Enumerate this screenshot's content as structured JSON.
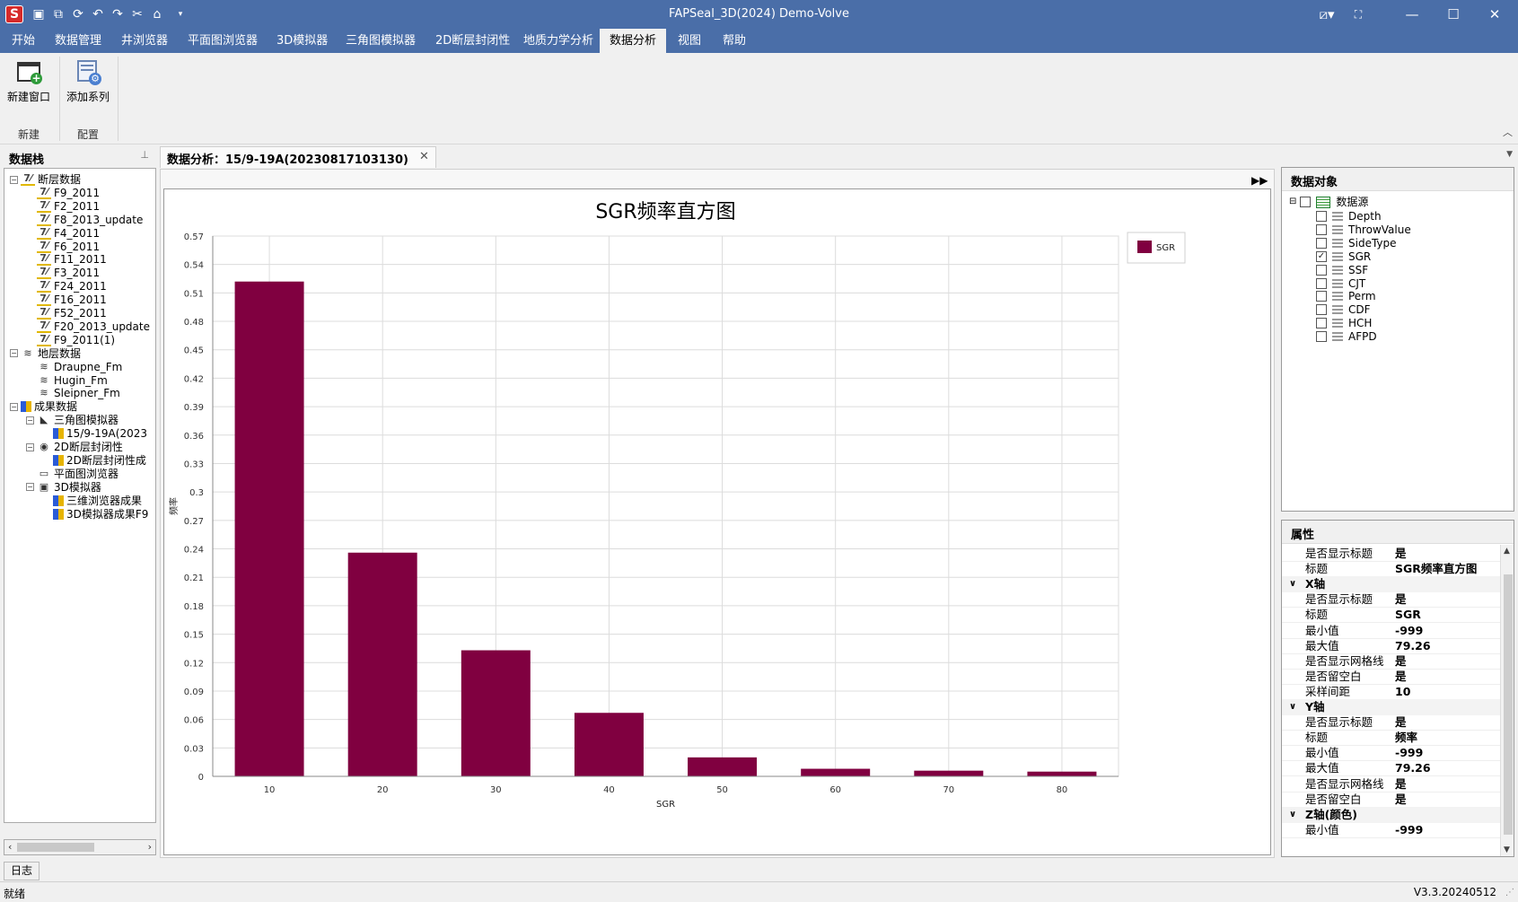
{
  "window": {
    "title": "FAPSeal_3D(2024) Demo-Volve",
    "logo_letter": "S"
  },
  "menu": [
    "开始",
    "数据管理",
    "井浏览器",
    "平面图浏览器",
    "3D模拟器",
    "三角图模拟器",
    "2D断层封闭性",
    "地质力学分析",
    "数据分析",
    "视图",
    "帮助"
  ],
  "ribbon": {
    "new_window": "新建窗口",
    "add_series": "添加系列",
    "group_new": "新建",
    "group_config": "配置"
  },
  "left_panel": {
    "title": "数据栈",
    "tree": [
      {
        "label": "断层数据",
        "level": 0,
        "icon": "fault",
        "expand": "⊟"
      },
      {
        "label": "F9_2011",
        "level": 1,
        "icon": "fault"
      },
      {
        "label": "F2_2011",
        "level": 1,
        "icon": "fault"
      },
      {
        "label": "F8_2013_update",
        "level": 1,
        "icon": "fault"
      },
      {
        "label": "F4_2011",
        "level": 1,
        "icon": "fault"
      },
      {
        "label": "F6_2011",
        "level": 1,
        "icon": "fault"
      },
      {
        "label": "F11_2011",
        "level": 1,
        "icon": "fault"
      },
      {
        "label": "F3_2011",
        "level": 1,
        "icon": "fault"
      },
      {
        "label": "F24_2011",
        "level": 1,
        "icon": "fault"
      },
      {
        "label": "F16_2011",
        "level": 1,
        "icon": "fault"
      },
      {
        "label": "F52_2011",
        "level": 1,
        "icon": "fault"
      },
      {
        "label": "F20_2013_update",
        "level": 1,
        "icon": "fault"
      },
      {
        "label": "F9_2011(1)",
        "level": 1,
        "icon": "fault"
      },
      {
        "label": "地层数据",
        "level": 0,
        "icon": "layer",
        "expand": "⊟"
      },
      {
        "label": "Draupne_Fm",
        "level": 1,
        "icon": "layer"
      },
      {
        "label": "Hugin_Fm",
        "level": 1,
        "icon": "layer"
      },
      {
        "label": "Sleipner_Fm",
        "level": 1,
        "icon": "layer"
      },
      {
        "label": "成果数据",
        "level": 0,
        "icon": "result",
        "expand": "⊟"
      },
      {
        "label": "三角图模拟器",
        "level": 1,
        "icon": "triangle",
        "expand": "⊟"
      },
      {
        "label": "15/9-19A(2023",
        "level": 2,
        "icon": "result"
      },
      {
        "label": "2D断层封闭性",
        "level": 1,
        "icon": "eye",
        "expand": "⊟"
      },
      {
        "label": "2D断层封闭性成",
        "level": 2,
        "icon": "result"
      },
      {
        "label": "平面图浏览器",
        "level": 1,
        "icon": "map"
      },
      {
        "label": "3D模拟器",
        "level": 1,
        "icon": "cube",
        "expand": "⊟"
      },
      {
        "label": "三维浏览器成果",
        "level": 2,
        "icon": "result"
      },
      {
        "label": "3D模拟器成果F9",
        "level": 2,
        "icon": "result"
      }
    ]
  },
  "doc_tab": {
    "label": "数据分析：15/9-19A(20230817103130)"
  },
  "chart_data": {
    "type": "bar",
    "title": "SGR频率直方图",
    "xlabel": "SGR",
    "ylabel": "频率",
    "categories": [
      "10",
      "20",
      "30",
      "40",
      "50",
      "60",
      "70",
      "80"
    ],
    "series": [
      {
        "name": "SGR",
        "color": "#800040",
        "values": [
          0.522,
          0.236,
          0.133,
          0.067,
          0.02,
          0.008,
          0.006,
          0.005
        ]
      }
    ],
    "y_ticks": [
      "0",
      "0.03",
      "0.06",
      "0.09",
      "0.12",
      "0.15",
      "0.18",
      "0.21",
      "0.24",
      "0.27",
      "0.3",
      "0.33",
      "0.36",
      "0.39",
      "0.42",
      "0.45",
      "0.48",
      "0.51",
      "0.54",
      "0.57"
    ],
    "ylim": [
      0,
      0.57
    ],
    "grid": true,
    "legend": "top-right"
  },
  "data_objects": {
    "title": "数据对象",
    "root": "数据源",
    "items": [
      {
        "label": "Depth",
        "checked": false
      },
      {
        "label": "ThrowValue",
        "checked": false
      },
      {
        "label": "SideType",
        "checked": false
      },
      {
        "label": "SGR",
        "checked": true
      },
      {
        "label": "SSF",
        "checked": false
      },
      {
        "label": "CJT",
        "checked": false
      },
      {
        "label": "Perm",
        "checked": false
      },
      {
        "label": "CDF",
        "checked": false
      },
      {
        "label": "HCH",
        "checked": false
      },
      {
        "label": "AFPD",
        "checked": false
      }
    ]
  },
  "properties": {
    "title": "属性",
    "rows": [
      {
        "kind": "prop",
        "name": "是否显示标题",
        "value": "是"
      },
      {
        "kind": "prop",
        "name": "标题",
        "value": "SGR频率直方图"
      },
      {
        "kind": "cat",
        "name": "X轴"
      },
      {
        "kind": "prop",
        "name": "是否显示标题",
        "value": "是"
      },
      {
        "kind": "prop",
        "name": "标题",
        "value": "SGR"
      },
      {
        "kind": "prop",
        "name": "最小值",
        "value": "-999"
      },
      {
        "kind": "prop",
        "name": "最大值",
        "value": "79.26"
      },
      {
        "kind": "prop",
        "name": "是否显示网格线",
        "value": "是"
      },
      {
        "kind": "prop",
        "name": "是否留空白",
        "value": "是"
      },
      {
        "kind": "prop",
        "name": "采样间距",
        "value": "10"
      },
      {
        "kind": "cat",
        "name": "Y轴"
      },
      {
        "kind": "prop",
        "name": "是否显示标题",
        "value": "是"
      },
      {
        "kind": "prop",
        "name": "标题",
        "value": "频率"
      },
      {
        "kind": "prop",
        "name": "最小值",
        "value": "-999"
      },
      {
        "kind": "prop",
        "name": "最大值",
        "value": "79.26"
      },
      {
        "kind": "prop",
        "name": "是否显示网格线",
        "value": "是"
      },
      {
        "kind": "prop",
        "name": "是否留空白",
        "value": "是"
      },
      {
        "kind": "cat",
        "name": "Z轴(颜色)"
      },
      {
        "kind": "prop",
        "name": "最小值",
        "value": "-999"
      }
    ]
  },
  "bottom": {
    "log_tab": "日志",
    "status": "就绪",
    "version": "V3.3.20240512"
  }
}
